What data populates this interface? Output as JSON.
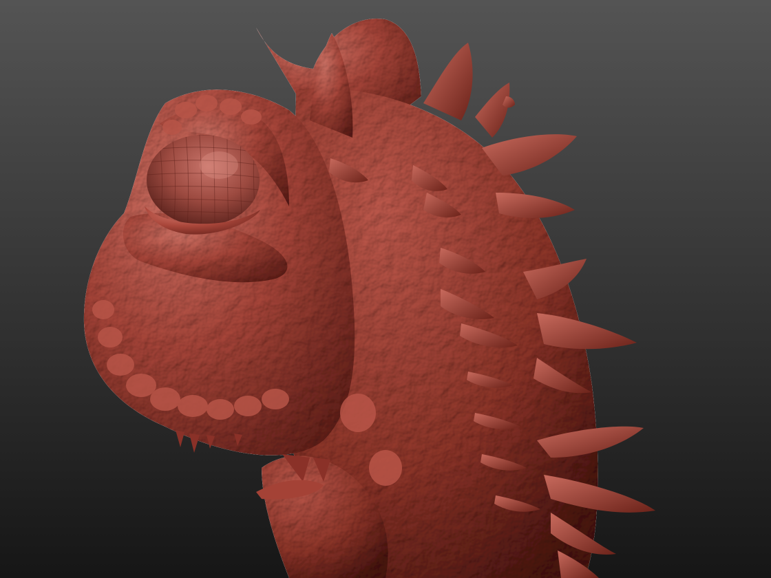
{
  "viewport": {
    "background_top": "#545454",
    "background_bottom": "#161616"
  },
  "render": {
    "subject": "sculpted-creature-head",
    "material_base": "#a9463a",
    "material_light": "#d7776a",
    "material_shadow": "#5b1c16",
    "material_deep": "#3a0f0b",
    "eye_wireframe": true
  }
}
